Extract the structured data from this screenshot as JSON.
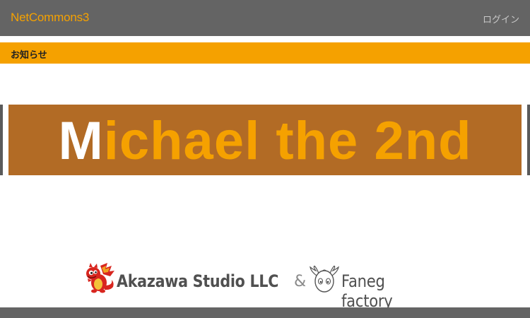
{
  "header": {
    "brand": "NetCommons3",
    "login_label": "ログイン"
  },
  "notice": {
    "title": "お知らせ"
  },
  "banner": {
    "title_first_letter": "M",
    "title_rest": "ichael the 2nd"
  },
  "credits": {
    "studio": "Akazawa Studio LLC",
    "ampersand": "&",
    "factory": "Faneg factory"
  },
  "colors": {
    "header_bg": "#646464",
    "accent": "#f5a100",
    "banner_bg": "#b26b25"
  },
  "icons": {
    "dragon": "red-dragon-mascot-icon",
    "egg": "winged-egg-mascot-icon"
  }
}
